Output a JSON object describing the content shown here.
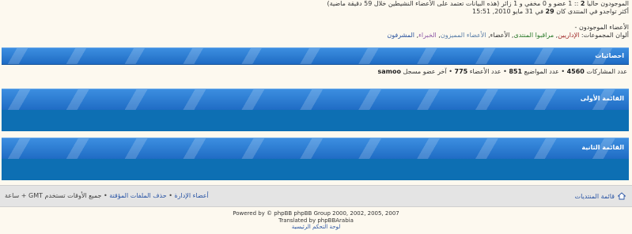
{
  "online": {
    "line1_prefix": "الموجودون حالياً",
    "line1_count": "2",
    "line1_rest": ":: 1 عضو و 0 مخفي و 1 زائر (هذه البيانات تعتمد على الأعضاء النشيطين خلال 59 دقيقة ماضية)",
    "line2_prefix": "أكثر تواجدو في المنتدى كان",
    "line2_count": "29",
    "line2_rest": "في 31 مايو 2010, 15:51",
    "members_label": "الأعضاء الموجودون",
    "members_value": "-",
    "legend_label": "ألوان المجموعات:",
    "groups": [
      "الإداريين",
      "مراقبوا المنتدى",
      "الأعضاء",
      "الأعضاء المميزون",
      "الخبراء",
      "المشرفون"
    ]
  },
  "stats": {
    "title": "احصائيات",
    "posts_label": "عدد المشاركات",
    "posts": "4560",
    "topics_label": "عدد المواضيع",
    "topics": "851",
    "members_label": "عدد الأعضاء",
    "members": "775",
    "newest_label": "آخر عضو مسجل",
    "newest": "samoo",
    "sep": "•"
  },
  "panels": [
    {
      "title": "القائمة الأولى"
    },
    {
      "title": "القائمة الثانية"
    }
  ],
  "footer": {
    "board_index": "قائمة المنتديات",
    "team": "أعضاء الإدارة",
    "delete_cookies": "حذف الملفات المؤقتة",
    "timezone": "جميع الأوقات تستخدم GMT + ساعة",
    "sep": "•"
  },
  "credits": {
    "powered": "Powered by © phpBB phpBB Group 2000, 2002, 2005, 2007",
    "translated": "Translated by phpBBArabia",
    "acp": "لوحة التحكم الرئيسية"
  },
  "colors": {
    "bar": "#2f80d4",
    "panel": "#0d6fb3",
    "footer": "#e4e4e4",
    "link": "#2a55a5"
  }
}
